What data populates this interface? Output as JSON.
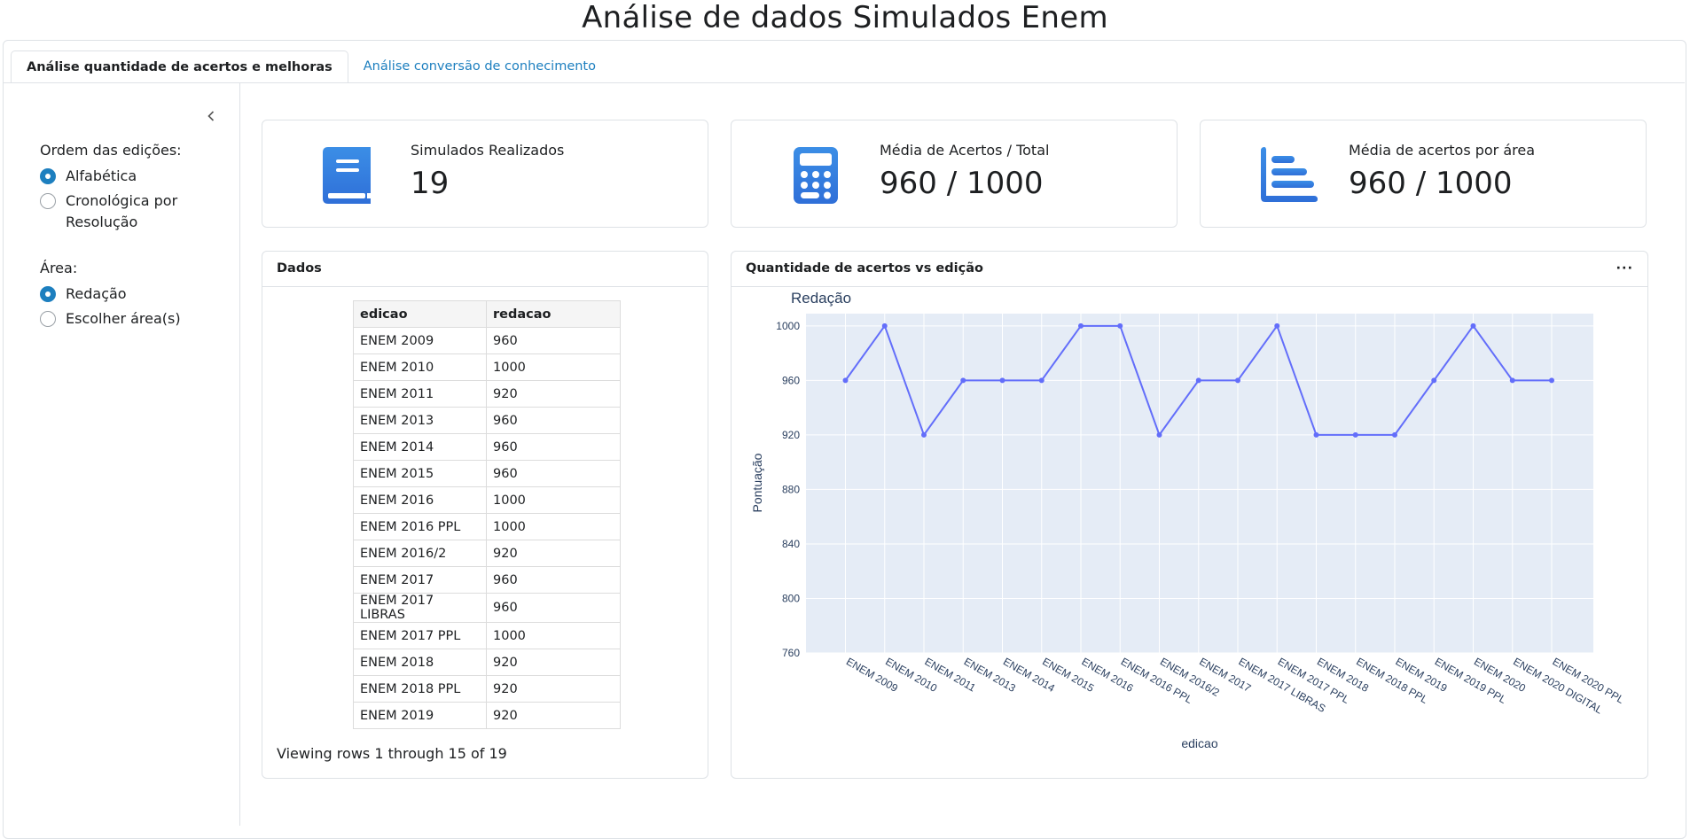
{
  "title": "Análise de dados Simulados Enem",
  "tabs": [
    {
      "label": "Análise quantidade de acertos e melhoras",
      "active": true
    },
    {
      "label": "Análise conversão de conhecimento",
      "active": false
    }
  ],
  "sidebar": {
    "collapse_icon": "chevron-left-icon",
    "order_label": "Ordem das edições:",
    "order_options": [
      {
        "label": "Alfabética",
        "selected": true
      },
      {
        "label": "Cronológica por Resolução",
        "selected": false
      }
    ],
    "area_label": "Área:",
    "area_options": [
      {
        "label": "Redação",
        "selected": true
      },
      {
        "label": "Escolher área(s)",
        "selected": false
      }
    ]
  },
  "value_boxes": [
    {
      "title": "Simulados Realizados",
      "value": "19",
      "icon": "book-icon"
    },
    {
      "title": "Média de Acertos / Total",
      "value": "960 / 1000",
      "icon": "calculator-icon"
    },
    {
      "title": "Média de acertos por área",
      "value": "960 / 1000",
      "icon": "bar-chart-horizontal-icon"
    }
  ],
  "data_card": {
    "title": "Dados",
    "columns": [
      "edicao",
      "redacao"
    ],
    "rows": [
      [
        "ENEM 2009",
        "960"
      ],
      [
        "ENEM 2010",
        "1000"
      ],
      [
        "ENEM 2011",
        "920"
      ],
      [
        "ENEM 2013",
        "960"
      ],
      [
        "ENEM 2014",
        "960"
      ],
      [
        "ENEM 2015",
        "960"
      ],
      [
        "ENEM 2016",
        "1000"
      ],
      [
        "ENEM 2016 PPL",
        "1000"
      ],
      [
        "ENEM 2016/2",
        "920"
      ],
      [
        "ENEM 2017",
        "960"
      ],
      [
        "ENEM 2017 LIBRAS",
        "960"
      ],
      [
        "ENEM 2017 PPL",
        "1000"
      ],
      [
        "ENEM 2018",
        "920"
      ],
      [
        "ENEM 2018 PPL",
        "920"
      ],
      [
        "ENEM 2019",
        "920"
      ]
    ],
    "footer": "Viewing rows 1 through 15 of 19"
  },
  "chart_card": {
    "title": "Quantidade de acertos vs edição",
    "menu_icon": "more-horizontal-icon"
  },
  "chart_data": {
    "type": "line",
    "title": "Redação",
    "xlabel": "edicao",
    "ylabel": "Pontuação",
    "categories": [
      "ENEM 2009",
      "ENEM 2010",
      "ENEM 2011",
      "ENEM 2013",
      "ENEM 2014",
      "ENEM 2015",
      "ENEM 2016",
      "ENEM 2016 PPL",
      "ENEM 2016/2",
      "ENEM 2017",
      "ENEM 2017 LIBRAS",
      "ENEM 2017 PPL",
      "ENEM 2018",
      "ENEM 2018 PPL",
      "ENEM 2019",
      "ENEM 2019 PPL",
      "ENEM 2020",
      "ENEM 2020 DIGITAL",
      "ENEM 2020 PPL"
    ],
    "values": [
      960,
      1000,
      920,
      960,
      960,
      960,
      1000,
      1000,
      920,
      960,
      960,
      1000,
      920,
      920,
      920,
      960,
      1000,
      960,
      960
    ],
    "yticks": [
      760,
      800,
      840,
      880,
      920,
      960,
      1000
    ],
    "ylim": [
      760,
      1009
    ],
    "grid": true,
    "colors": {
      "line": "#636efa",
      "plot_bg": "#e5ecf6",
      "text": "#2a3f5f"
    }
  }
}
